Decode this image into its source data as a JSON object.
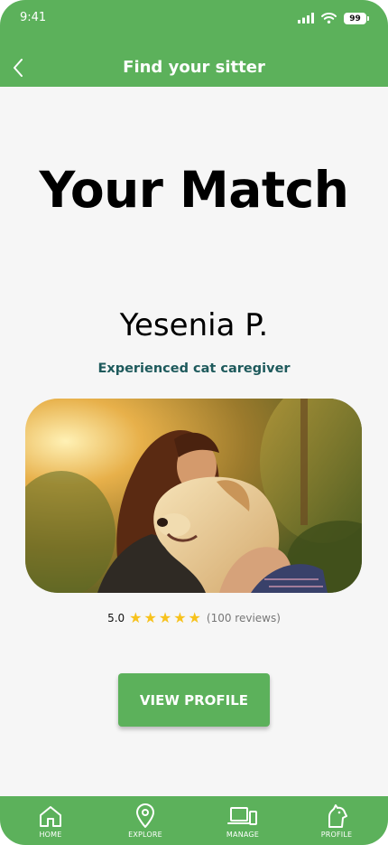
{
  "status_bar": {
    "time": "9:41",
    "battery": "99"
  },
  "header": {
    "title": "Find your sitter",
    "back_icon": "chevron-left-icon"
  },
  "main": {
    "heading": "Your Match",
    "sitter_name": "Yesenia P.",
    "sitter_subtitle": "Experienced cat caregiver",
    "photo": "sitter-hugging-golden-retriever",
    "rating": {
      "value": "5.0",
      "stars": 5,
      "max_stars": 5,
      "reviews": "(100 reviews)"
    },
    "button_label": "VIEW PROFILE"
  },
  "bottom_nav": {
    "items": [
      {
        "label": "HOME",
        "icon": "home-icon"
      },
      {
        "label": "EXPLORE",
        "icon": "location-pin-icon"
      },
      {
        "label": "MANAGE",
        "icon": "devices-icon"
      },
      {
        "label": "PROFILE",
        "icon": "pet-profile-icon"
      }
    ]
  },
  "colors": {
    "brand_green": "#5cb15b",
    "subtitle_teal": "#1e5a5c",
    "star_yellow": "#f7c21c",
    "background": "#f6f6f6"
  }
}
